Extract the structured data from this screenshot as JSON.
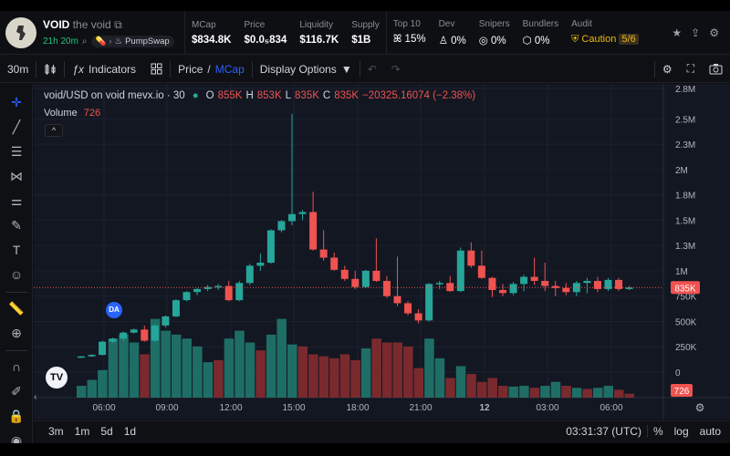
{
  "token": {
    "name": "VOID",
    "fullname": "the void",
    "age": "21h 20m",
    "platform": "PumpSwap"
  },
  "stats": [
    {
      "label": "MCap",
      "value": "$834.8K"
    },
    {
      "label": "Price",
      "value": "$0.0₅834"
    },
    {
      "label": "Liquidity",
      "value": "$116.7K"
    },
    {
      "label": "Supply",
      "value": "$1B"
    }
  ],
  "holders": [
    {
      "label": "Top 10",
      "value": "15%"
    },
    {
      "label": "Dev",
      "value": "0%"
    },
    {
      "label": "Snipers",
      "value": "0%"
    },
    {
      "label": "Bundlers",
      "value": "0%"
    }
  ],
  "audit": {
    "label": "Audit",
    "value": "Caution",
    "score": "5/6"
  },
  "toolbar": {
    "interval": "30m",
    "indicators": "Indicators",
    "price": "Price",
    "slash": "/",
    "mcap": "MCap",
    "display": "Display Options"
  },
  "legend": {
    "symbol": "void/USD on void mevx.io · 30",
    "o_label": "O",
    "o": "855K",
    "h_label": "H",
    "h": "853K",
    "l_label": "L",
    "l": "835K",
    "c_label": "C",
    "c": "835K",
    "change": "−20325.16074 (−2.38%)",
    "volume_label": "Volume",
    "volume": "726"
  },
  "markers": {
    "da": "DA",
    "tv": "TV"
  },
  "bottom": {
    "ranges": [
      "3m",
      "1m",
      "5d",
      "1d"
    ],
    "time": "03:31:37 (UTC)",
    "percent": "%",
    "log": "log",
    "auto": "auto"
  },
  "colors": {
    "up": "#26a69a",
    "down": "#ef5350",
    "accent": "#2962ff"
  },
  "chart_data": {
    "type": "candlestick",
    "y_ticks": [
      "2.8M",
      "2.5M",
      "2.3M",
      "2M",
      "1.8M",
      "1.5M",
      "1.3M",
      "1M",
      "750K",
      "500K",
      "250K",
      "0"
    ],
    "y_tick_values": [
      2800000,
      2500000,
      2250000,
      2000000,
      1750000,
      1500000,
      1250000,
      1000000,
      750000,
      500000,
      250000,
      0
    ],
    "x_ticks": [
      "06:00",
      "09:00",
      "12:00",
      "15:00",
      "18:00",
      "21:00",
      "12",
      "03:00",
      "06:00"
    ],
    "last_price_label": "835K",
    "last_volume_label": "726",
    "candles": [
      {
        "o": 150000,
        "h": 160000,
        "l": 140000,
        "c": 155000
      },
      {
        "o": 155000,
        "h": 175000,
        "l": 150000,
        "c": 170000
      },
      {
        "o": 170000,
        "h": 310000,
        "l": 165000,
        "c": 300000
      },
      {
        "o": 300000,
        "h": 340000,
        "l": 290000,
        "c": 330000
      },
      {
        "o": 330000,
        "h": 400000,
        "l": 310000,
        "c": 390000
      },
      {
        "o": 390000,
        "h": 430000,
        "l": 380000,
        "c": 420000
      },
      {
        "o": 420000,
        "h": 460000,
        "l": 300000,
        "c": 310000
      },
      {
        "o": 310000,
        "h": 470000,
        "l": 300000,
        "c": 460000
      },
      {
        "o": 460000,
        "h": 560000,
        "l": 440000,
        "c": 550000
      },
      {
        "o": 550000,
        "h": 720000,
        "l": 540000,
        "c": 710000
      },
      {
        "o": 710000,
        "h": 800000,
        "l": 700000,
        "c": 790000
      },
      {
        "o": 790000,
        "h": 830000,
        "l": 760000,
        "c": 820000
      },
      {
        "o": 820000,
        "h": 860000,
        "l": 800000,
        "c": 840000
      },
      {
        "o": 840000,
        "h": 870000,
        "l": 810000,
        "c": 850000
      },
      {
        "o": 850000,
        "h": 900000,
        "l": 700000,
        "c": 710000
      },
      {
        "o": 710000,
        "h": 900000,
        "l": 700000,
        "c": 880000
      },
      {
        "o": 880000,
        "h": 1070000,
        "l": 860000,
        "c": 1050000
      },
      {
        "o": 1050000,
        "h": 1170000,
        "l": 1000000,
        "c": 1080000
      },
      {
        "o": 1080000,
        "h": 1410000,
        "l": 1070000,
        "c": 1400000
      },
      {
        "o": 1400000,
        "h": 1500000,
        "l": 1380000,
        "c": 1490000
      },
      {
        "o": 1490000,
        "h": 2550000,
        "l": 1450000,
        "c": 1560000
      },
      {
        "o": 1560000,
        "h": 1600000,
        "l": 1500000,
        "c": 1580000
      },
      {
        "o": 1580000,
        "h": 1780000,
        "l": 1200000,
        "c": 1210000
      },
      {
        "o": 1210000,
        "h": 1400000,
        "l": 1100000,
        "c": 1130000
      },
      {
        "o": 1130000,
        "h": 1180000,
        "l": 1000000,
        "c": 1010000
      },
      {
        "o": 1010000,
        "h": 1050000,
        "l": 900000,
        "c": 920000
      },
      {
        "o": 920000,
        "h": 1000000,
        "l": 820000,
        "c": 840000
      },
      {
        "o": 840000,
        "h": 1010000,
        "l": 830000,
        "c": 1000000
      },
      {
        "o": 1000000,
        "h": 1320000,
        "l": 890000,
        "c": 900000
      },
      {
        "o": 900000,
        "h": 950000,
        "l": 730000,
        "c": 750000
      },
      {
        "o": 750000,
        "h": 1140000,
        "l": 650000,
        "c": 680000
      },
      {
        "o": 680000,
        "h": 700000,
        "l": 560000,
        "c": 580000
      },
      {
        "o": 580000,
        "h": 620000,
        "l": 480000,
        "c": 510000
      },
      {
        "o": 510000,
        "h": 880000,
        "l": 500000,
        "c": 870000
      },
      {
        "o": 870000,
        "h": 900000,
        "l": 820000,
        "c": 880000
      },
      {
        "o": 880000,
        "h": 950000,
        "l": 790000,
        "c": 800000
      },
      {
        "o": 800000,
        "h": 1230000,
        "l": 790000,
        "c": 1200000
      },
      {
        "o": 1200000,
        "h": 1280000,
        "l": 1030000,
        "c": 1050000
      },
      {
        "o": 1050000,
        "h": 1200000,
        "l": 920000,
        "c": 930000
      },
      {
        "o": 930000,
        "h": 940000,
        "l": 740000,
        "c": 810000
      },
      {
        "o": 810000,
        "h": 870000,
        "l": 750000,
        "c": 780000
      },
      {
        "o": 780000,
        "h": 890000,
        "l": 760000,
        "c": 870000
      },
      {
        "o": 870000,
        "h": 960000,
        "l": 800000,
        "c": 940000
      },
      {
        "o": 940000,
        "h": 1130000,
        "l": 860000,
        "c": 900000
      },
      {
        "o": 900000,
        "h": 1080000,
        "l": 800000,
        "c": 850000
      },
      {
        "o": 850000,
        "h": 900000,
        "l": 750000,
        "c": 830000
      },
      {
        "o": 830000,
        "h": 880000,
        "l": 760000,
        "c": 790000
      },
      {
        "o": 790000,
        "h": 900000,
        "l": 750000,
        "c": 880000
      },
      {
        "o": 880000,
        "h": 930000,
        "l": 780000,
        "c": 900000
      },
      {
        "o": 900000,
        "h": 940000,
        "l": 790000,
        "c": 820000
      },
      {
        "o": 820000,
        "h": 930000,
        "l": 800000,
        "c": 910000
      },
      {
        "o": 910000,
        "h": 930000,
        "l": 800000,
        "c": 820000
      },
      {
        "o": 820000,
        "h": 850000,
        "l": 810000,
        "c": 835000
      }
    ],
    "volume_bars": [
      {
        "v": 30,
        "up": true
      },
      {
        "v": 45,
        "up": true
      },
      {
        "v": 70,
        "up": true
      },
      {
        "v": 150,
        "up": true
      },
      {
        "v": 160,
        "up": true
      },
      {
        "v": 140,
        "up": true
      },
      {
        "v": 110,
        "down": true,
        "up": false
      },
      {
        "v": 200,
        "up": true
      },
      {
        "v": 170,
        "up": true
      },
      {
        "v": 160,
        "up": true
      },
      {
        "v": 150,
        "up": true
      },
      {
        "v": 130,
        "up": true
      },
      {
        "v": 90,
        "up": true
      },
      {
        "v": 95,
        "up": false
      },
      {
        "v": 150,
        "up": true
      },
      {
        "v": 170,
        "up": true
      },
      {
        "v": 140,
        "up": true
      },
      {
        "v": 120,
        "up": false
      },
      {
        "v": 160,
        "up": true
      },
      {
        "v": 200,
        "up": true
      },
      {
        "v": 135,
        "up": true
      },
      {
        "v": 130,
        "up": false
      },
      {
        "v": 110,
        "up": false
      },
      {
        "v": 105,
        "up": false
      },
      {
        "v": 100,
        "up": false
      },
      {
        "v": 110,
        "up": false
      },
      {
        "v": 95,
        "up": false
      },
      {
        "v": 125,
        "up": true
      },
      {
        "v": 150,
        "up": false
      },
      {
        "v": 140,
        "up": false
      },
      {
        "v": 140,
        "up": false
      },
      {
        "v": 130,
        "up": false
      },
      {
        "v": 75,
        "up": false
      },
      {
        "v": 150,
        "up": true
      },
      {
        "v": 100,
        "up": true
      },
      {
        "v": 50,
        "up": false
      },
      {
        "v": 80,
        "up": true
      },
      {
        "v": 60,
        "up": false
      },
      {
        "v": 40,
        "up": false
      },
      {
        "v": 50,
        "up": false
      },
      {
        "v": 30,
        "up": false
      },
      {
        "v": 28,
        "up": true
      },
      {
        "v": 30,
        "up": true
      },
      {
        "v": 25,
        "up": false
      },
      {
        "v": 30,
        "up": true
      },
      {
        "v": 40,
        "up": true
      },
      {
        "v": 30,
        "up": false
      },
      {
        "v": 25,
        "up": true
      },
      {
        "v": 22,
        "up": false
      },
      {
        "v": 25,
        "up": true
      },
      {
        "v": 30,
        "up": true
      },
      {
        "v": 20,
        "up": false
      },
      {
        "v": 10,
        "up": false
      }
    ]
  }
}
